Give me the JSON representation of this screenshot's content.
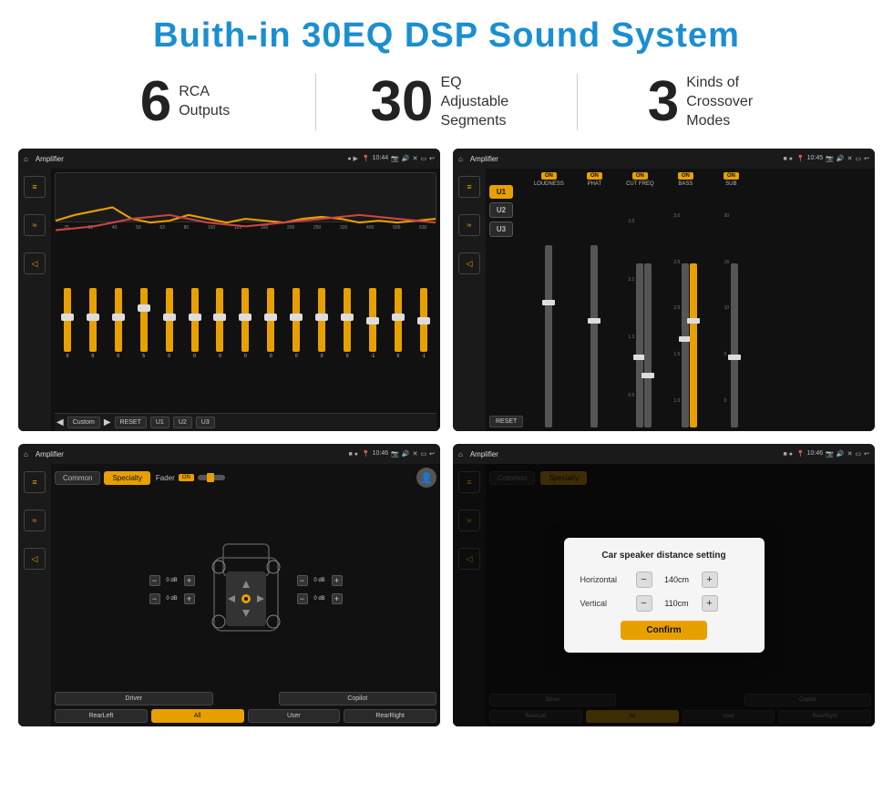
{
  "page": {
    "title": "Buith-in 30EQ DSP Sound System"
  },
  "stats": [
    {
      "number": "6",
      "label_line1": "RCA",
      "label_line2": "Outputs"
    },
    {
      "number": "30",
      "label_line1": "EQ Adjustable",
      "label_line2": "Segments"
    },
    {
      "number": "3",
      "label_line1": "Kinds of",
      "label_line2": "Crossover Modes"
    }
  ],
  "screen1": {
    "topbar": {
      "title": "Amplifier",
      "time": "10:44"
    },
    "eq_freqs": [
      "25",
      "32",
      "40",
      "50",
      "63",
      "80",
      "100",
      "125",
      "160",
      "200",
      "250",
      "320",
      "400",
      "500",
      "630"
    ],
    "eq_values": [
      "0",
      "0",
      "0",
      "5",
      "0",
      "0",
      "0",
      "0",
      "0",
      "0",
      "0",
      "0",
      "-1",
      "0",
      "-1"
    ],
    "buttons": [
      "Custom",
      "RESET",
      "U1",
      "U2",
      "U3"
    ]
  },
  "screen2": {
    "topbar": {
      "title": "Amplifier",
      "time": "10:45"
    },
    "u_buttons": [
      "U1",
      "U2",
      "U3"
    ],
    "channels": [
      {
        "on": true,
        "label": "LOUDNESS"
      },
      {
        "on": true,
        "label": "PHAT"
      },
      {
        "on": true,
        "label": "CUT FREQ"
      },
      {
        "on": true,
        "label": "BASS"
      },
      {
        "on": true,
        "label": "SUB"
      }
    ],
    "reset": "RESET"
  },
  "screen3": {
    "topbar": {
      "title": "Amplifier",
      "time": "10:46"
    },
    "mode_tabs": [
      "Common",
      "Specialty"
    ],
    "fader": "Fader",
    "fader_on": "ON",
    "vol_left1": "0 dB",
    "vol_left2": "0 dB",
    "vol_right1": "0 dB",
    "vol_right2": "0 dB",
    "bottom_buttons": [
      "Driver",
      "",
      "",
      "Copilot",
      "RearLeft",
      "All",
      "User",
      "RearRight"
    ]
  },
  "screen4": {
    "topbar": {
      "title": "Amplifier",
      "time": "10:46"
    },
    "dialog": {
      "title": "Car speaker distance setting",
      "horizontal_label": "Horizontal",
      "horizontal_value": "140cm",
      "vertical_label": "Vertical",
      "vertical_value": "110cm",
      "confirm_label": "Confirm"
    }
  }
}
